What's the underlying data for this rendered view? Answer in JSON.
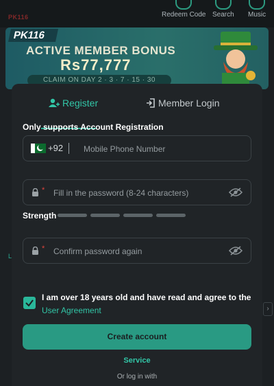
{
  "background": {
    "logo": "PK116",
    "nav": [
      {
        "label": "Redeem Code",
        "icon": "gift-icon"
      },
      {
        "label": "Search",
        "icon": "search-icon"
      },
      {
        "label": "Music",
        "icon": "music-icon"
      }
    ],
    "banner": {
      "badge": "PK116",
      "title": "ACTIVE MEMBER BONUS",
      "amount": "Rs77,777",
      "claim": "CLAIM ON DAY 2 · 3 · 7 · 15 · 30"
    }
  },
  "modal": {
    "tabs": [
      {
        "label": "Register",
        "icon": "user-add-icon",
        "active": true
      },
      {
        "label": "Member Login",
        "icon": "login-icon",
        "active": false
      }
    ],
    "hint": "Only supports Account Registration",
    "phone": {
      "country_code": "+92",
      "flag": "pakistan-flag-icon",
      "placeholder": "Mobile Phone Number"
    },
    "password": {
      "placeholder": "Fill in the password (8-24 characters)"
    },
    "strength": {
      "label": "Strength",
      "levels": 4
    },
    "confirm": {
      "placeholder": "Confirm password again"
    },
    "agreement": {
      "checked": true,
      "text": "I am over 18 years old and have read and agree to the",
      "link": "User Agreement"
    },
    "create_button": "Create account",
    "service": "Service",
    "or_login": "Or log in with"
  },
  "colors": {
    "accent": "#32c6a7",
    "button": "#299a83",
    "modal_bg": "#202427"
  }
}
